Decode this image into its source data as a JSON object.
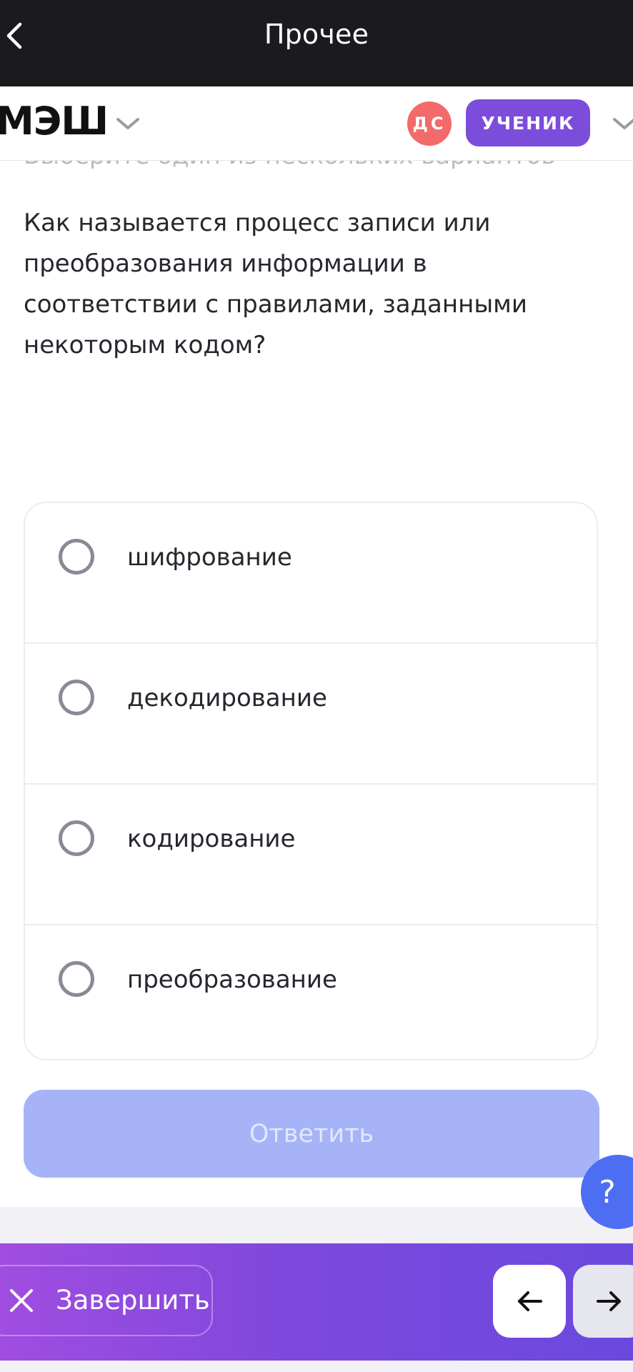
{
  "topbar": {
    "title": "Прочее",
    "back_icon": "chevron-left-icon"
  },
  "appbar": {
    "logo": "МЭШ",
    "avatar_initials": "ДС",
    "role": "УЧЕНИК",
    "colors": {
      "avatar": "#f26a6a",
      "role_badge": "#7c4ddb"
    }
  },
  "task": {
    "instruction": "Выберите один из нескольких вариантов",
    "question": "Как называется процесс записи или преобразования информации в соответствии с правилами, заданными некоторым кодом?",
    "options": [
      {
        "label": "шифрование",
        "selected": false
      },
      {
        "label": "декодирование",
        "selected": false
      },
      {
        "label": "кодирование",
        "selected": false
      },
      {
        "label": "преобразование",
        "selected": false
      }
    ],
    "submit_label": "Ответить",
    "submit_enabled": false
  },
  "help": {
    "label": "?"
  },
  "bottombar": {
    "finish_label": "Завершить",
    "prev_icon": "arrow-left-icon",
    "next_icon": "arrow-right-icon"
  }
}
